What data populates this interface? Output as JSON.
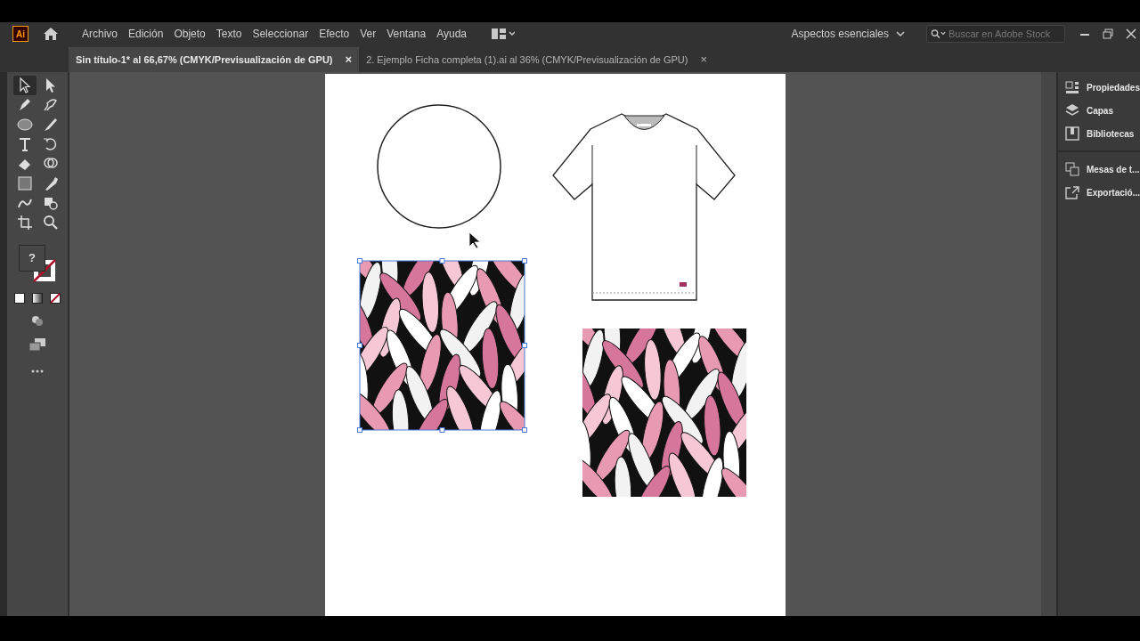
{
  "app": {
    "logo": "Ai"
  },
  "menu": [
    "Archivo",
    "Edición",
    "Objeto",
    "Texto",
    "Seleccionar",
    "Efecto",
    "Ver",
    "Ventana",
    "Ayuda"
  ],
  "workspace": {
    "label": "Aspectos esenciales"
  },
  "search": {
    "placeholder": "Buscar en Adobe Stock"
  },
  "tabs": [
    {
      "label": "Sin título-1* al 66,67% (CMYK/Previsualización de GPU)",
      "selected": true,
      "close": "×"
    },
    {
      "label": "2. Ejemplo Ficha completa (1).ai al 36% (CMYK/Previsualización de GPU)",
      "selected": false,
      "close": "×"
    }
  ],
  "tools": [
    {
      "selected": true
    },
    {
      "selected": false
    },
    {
      "selected": false
    },
    {
      "selected": false
    },
    {
      "selected": false
    },
    {
      "selected": false
    },
    {
      "selected": false
    },
    {
      "selected": false
    },
    {
      "selected": false
    },
    {
      "selected": false
    },
    {
      "selected": false
    },
    {
      "selected": false
    },
    {
      "selected": false
    },
    {
      "selected": false
    },
    {
      "selected": false
    },
    {
      "selected": false
    }
  ],
  "fill_stroke": {
    "fill_label": "?"
  },
  "artboard": {
    "objects": [
      {
        "kind": "circle",
        "selected": false
      },
      {
        "kind": "tshirt",
        "selected": false
      },
      {
        "kind": "pattern",
        "selected": true
      },
      {
        "kind": "pattern",
        "selected": false
      }
    ]
  },
  "panel_groups": [
    {
      "items": [
        {
          "label": "Propiedades"
        },
        {
          "label": "Capas"
        },
        {
          "label": "Bibliotecas"
        }
      ]
    },
    {
      "items": [
        {
          "label": "Mesas de t..."
        },
        {
          "label": "Exportació..."
        }
      ]
    }
  ]
}
